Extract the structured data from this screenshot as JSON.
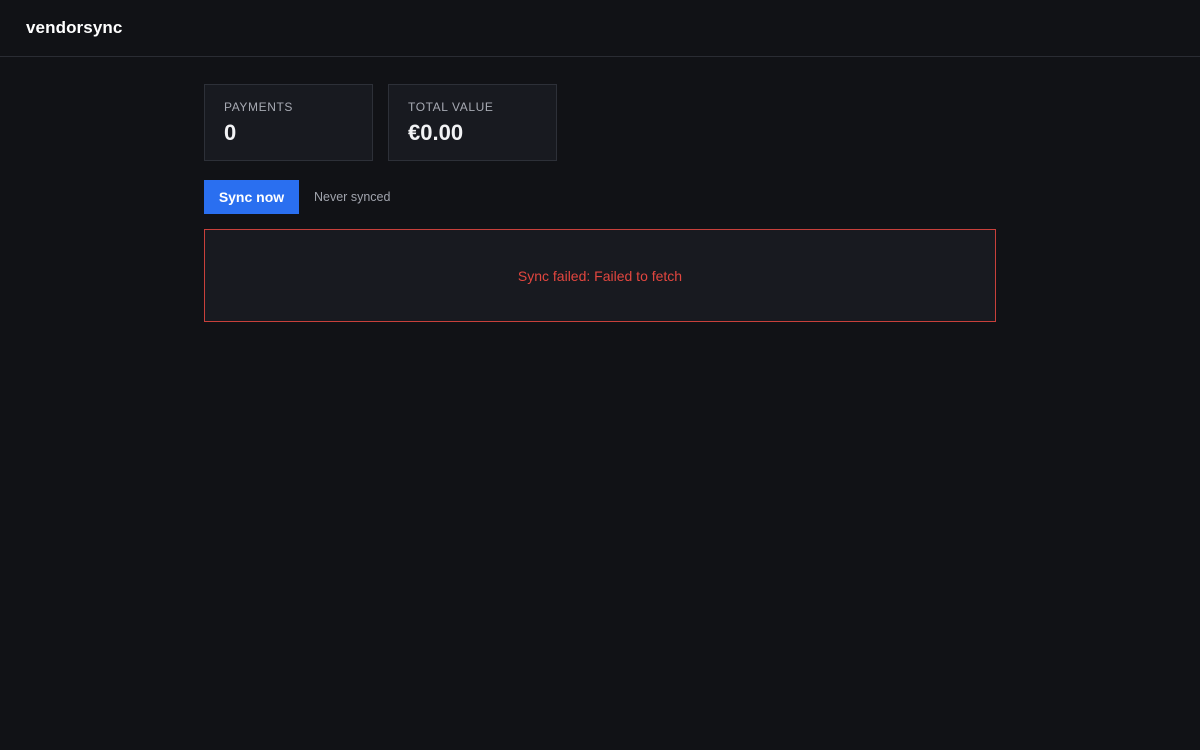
{
  "app": {
    "brand": "vendorsync"
  },
  "stats": [
    {
      "label": "PAYMENTS",
      "value": "0"
    },
    {
      "label": "TOTAL VALUE",
      "value": "€0.00"
    }
  ],
  "sync": {
    "button_label": "Sync now",
    "status": "Never synced"
  },
  "error": {
    "message": "Sync failed: Failed to fetch"
  },
  "colors": {
    "background": "#111216",
    "card": "#181a20",
    "accent": "#2a6ff0",
    "error": "#e2463f"
  }
}
